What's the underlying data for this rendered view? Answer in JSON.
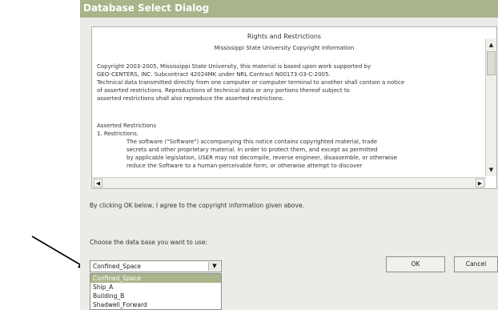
{
  "window": {
    "title": "Database Select Dialog"
  },
  "license": {
    "heading": "Rights and Restrictions",
    "subheading": "Mississippi State University Copyright Information",
    "paragraph1": [
      "Copyright 2003-2005, Mississippi State University, this material is based upon work supported by",
      "GEO-CENTERS, INC. Subcontract 42024MK under NRL Contract N00173-03-C-2005.",
      "Technical data transmitted directly from one computer or computer terminal to another shall contain a notice",
      "of asserted restrictions. Reproductions of technical data or any portions thereof subject to",
      "asserted restrictions shall also reproduce the asserted restrictions."
    ],
    "paragraph2_title": "Asserted Restrictions",
    "paragraph2_item": "1. Restrictions.",
    "paragraph2_body": [
      "The software (\"Software\") accompanying this notice contains copyrighted material, trade",
      "secrets and other proprietary material. In order to protect them, and except as permitted",
      "by applicable legislation, USER may not decompile, reverse engineer, disassemble, or otherwise",
      "reduce the Software to a human-perceivable form, or otherwise attempt to discover"
    ]
  },
  "agreement_text": "By clicking OK below, I agree to the copyright information given above.",
  "choose_label": "Choose the data base you want to use:",
  "database_select": {
    "value": "Confined_Space",
    "options": [
      "Confined_Space",
      "Ship_A",
      "Building_B",
      "Shadwell_Forward"
    ]
  },
  "buttons": {
    "ok": "OK",
    "cancel": "Cancel"
  },
  "icons": {
    "dropdown": "chevron-down-icon",
    "scroll_up": "arrow-up-icon",
    "scroll_down": "arrow-down-icon",
    "scroll_left": "arrow-left-icon",
    "scroll_right": "arrow-right-icon",
    "pointer": "pointer-arrow-icon"
  },
  "colors": {
    "titlebar": "#a8b58a",
    "selection": "#a8b58a",
    "dialog_bg": "#ebebe7"
  }
}
